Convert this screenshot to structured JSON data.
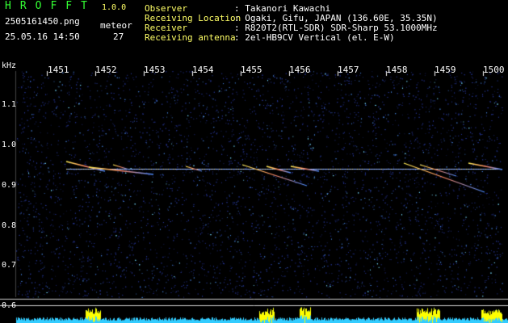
{
  "header": {
    "app_title": "HROFFT",
    "app_version": "1.0.0",
    "filename": "2505161450.png",
    "timestamp": "25.05.16 14:50",
    "meteor_label": "meteor",
    "meteor_count": "27",
    "info": [
      {
        "key": "Observer",
        "value": ": Takanori Kawachi"
      },
      {
        "key": "Receiving Location",
        "value": ": Ogaki, Gifu, JAPAN (136.60E, 35.35N)"
      },
      {
        "key": "Receiver",
        "value": ": R820T2(RTL-SDR) SDR-Sharp 53.1000MHz"
      },
      {
        "key": "Receiving antenna",
        "value": ": 2el-HB9CV Vertical (el. E-W)"
      }
    ]
  },
  "spectrogram": {
    "y_unit": "kHz",
    "x_ticks": [
      "1451",
      "1452",
      "1453",
      "1454",
      "1455",
      "1456",
      "1457",
      "1458",
      "1459",
      "1500"
    ],
    "y_ticks": [
      "1.1",
      "1.0",
      "0.9",
      "0.8",
      "0.7",
      "0.6"
    ],
    "colors": {
      "background": "#000000",
      "noise": "#1a2a88",
      "signal": "#ffee55",
      "level": "#33ccff",
      "peak": "#ffff00"
    }
  }
}
